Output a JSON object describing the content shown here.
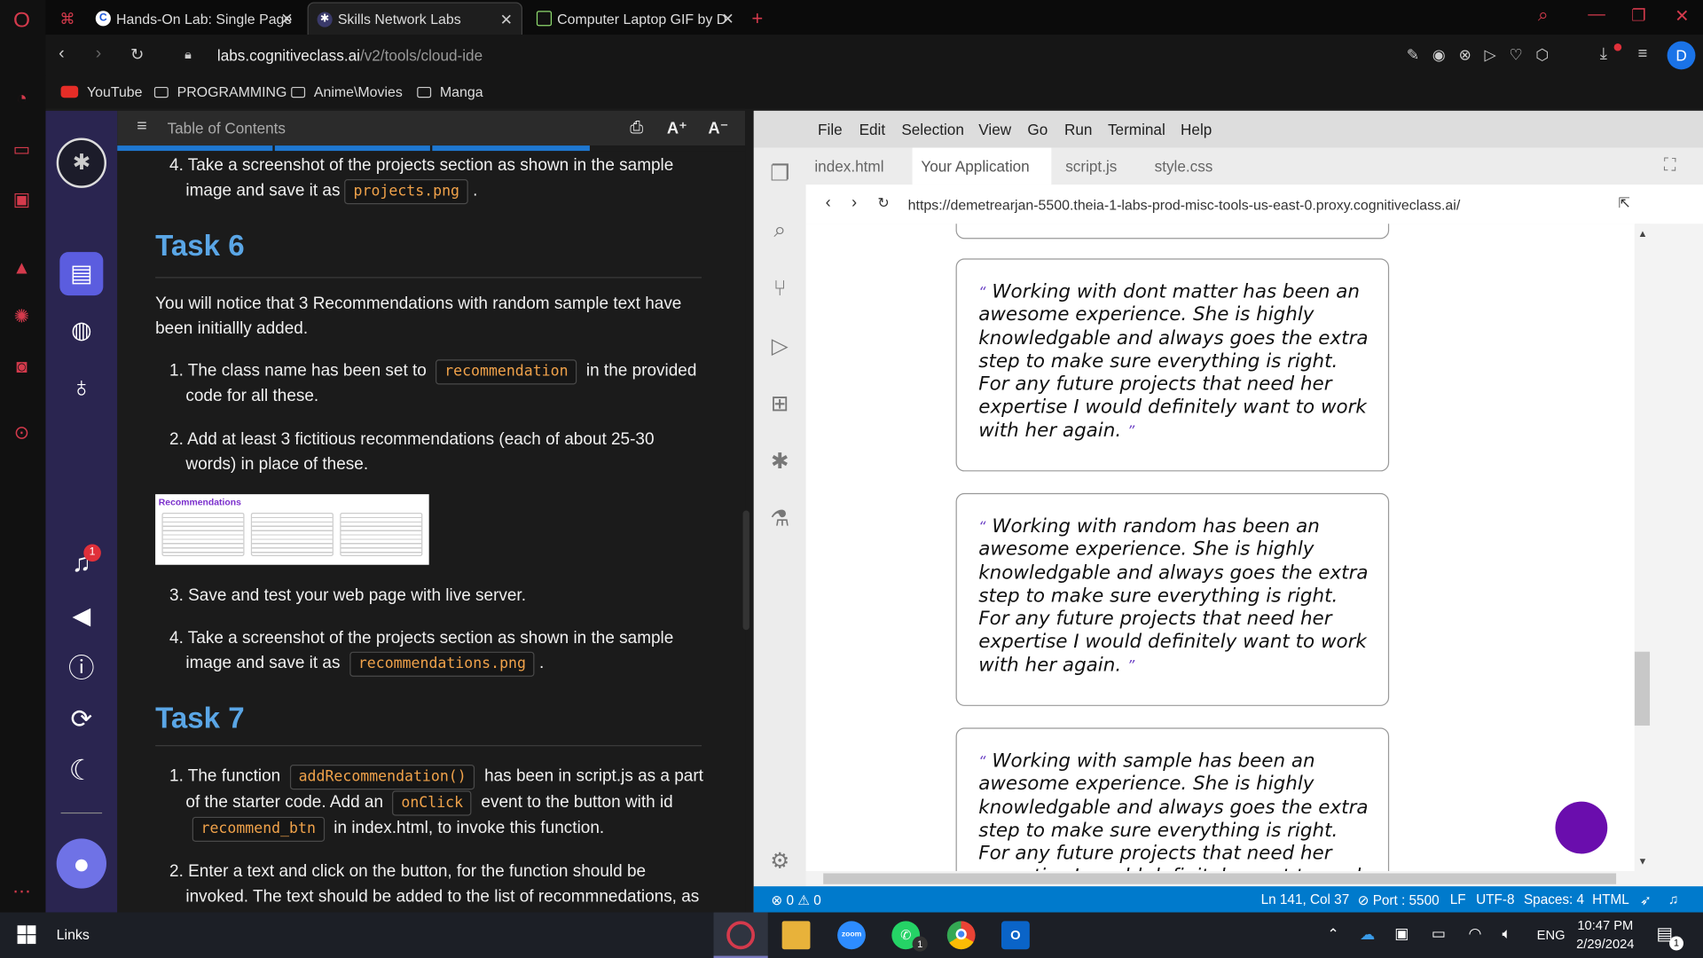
{
  "browser": {
    "tabs": [
      {
        "label": "Hands-On Lab: Single Page",
        "icon": "coursera-c-icon"
      },
      {
        "label": "Skills Network Labs",
        "icon": "skills-network-icon"
      },
      {
        "label": "Computer Laptop GIF by D",
        "icon": "giphy-icon"
      }
    ],
    "url_domain": "labs.cognitiveclass.ai",
    "url_path": "/v2/tools/cloud-ide",
    "profile_initial": "D",
    "bookmarks": [
      "YouTube",
      "PROGRAMMING",
      "Anime\\Movies",
      "Manga"
    ]
  },
  "lab": {
    "toc_label": "Table of Contents",
    "font_up": "A⁺",
    "font_down": "A⁻",
    "notification_count": "1",
    "items": {
      "t5_step4_a": "4. Take a screenshot of the projects section as shown in the sample",
      "t5_step4_b": "image and save it as",
      "t5_code": "projects.png",
      "task6_title": "Task 6",
      "task6_intro_a": "You will notice that 3 Recommendations with random sample text have",
      "task6_intro_b": "been initiallly added.",
      "t6_s1_a": "1. The class name has been set to",
      "t6_s1_code": "recommendation",
      "t6_s1_b": "in the provided",
      "t6_s1_c": "code for all these.",
      "t6_s2_a": "2. Add at least 3 fictitious recommendations (each of about 25-30",
      "t6_s2_b": "words) in place of these.",
      "thumb_title": "Recommendations",
      "t6_s3": "3. Save and test your web page with live server.",
      "t6_s4_a": "4. Take a screenshot of the projects section as shown in the sample",
      "t6_s4_b": "image and save it as",
      "t6_s4_code": "recommendations.png",
      "task7_title": "Task 7",
      "t7_s1_a": "1. The function",
      "t7_s1_code": "addRecommendation()",
      "t7_s1_b": "has been in script.js as a part",
      "t7_s1_c": "of the starter code. Add an",
      "t7_s1_code2": "onClick",
      "t7_s1_d": "event to the button with id",
      "t7_s1_code3": "recommend_btn",
      "t7_s1_e": "in index.html, to invoke this function.",
      "t7_s2_a": "2. Enter a text and click on the button, for the function should be",
      "t7_s2_b": "invoked. The text should be added to the list of recommnedations, as"
    }
  },
  "ide": {
    "menu": [
      "File",
      "Edit",
      "Selection",
      "View",
      "Go",
      "Run",
      "Terminal",
      "Help"
    ],
    "tabs": [
      "index.html",
      "Your Application",
      "script.js",
      "style.css"
    ],
    "preview_url": "https://demetrearjan-5500.theia-1-labs-prod-misc-tools-us-east-0.proxy.cognitiveclass.ai/",
    "recommendations": [
      "Working with dont matter has been an awesome experience. She is highly knowledgable and always goes the extra step to make sure everything is right. For any future projects that need her expertise I would definitely want to work with her again.",
      "Working with random has been an awesome experience. She is highly knowledgable and always goes the extra step to make sure everything is right. For any future projects that need her expertise I would definitely want to work with her again.",
      "Working with sample has been an awesome experience. She is highly knowledgable and always goes the extra step to make sure everything is right. For any future projects that need her expertise I would definitely want to work with her again."
    ],
    "status": {
      "errors": "0",
      "warnings": "0",
      "position": "Ln 141, Col 37",
      "port": "Port : 5500",
      "eol": "LF",
      "encoding": "UTF-8",
      "spaces": "Spaces: 4",
      "language": "HTML"
    }
  },
  "taskbar": {
    "links": "Links",
    "whatsapp_badge": "1",
    "lang": "ENG",
    "time": "10:47 PM",
    "date": "2/29/2024",
    "notif_badge": "1"
  },
  "colors": {
    "accent": "#007acc",
    "heading": "#5aa6e6",
    "code": "#f0a24a",
    "lab_sidebar": "#2a2550",
    "fab": "#6a0dad"
  }
}
